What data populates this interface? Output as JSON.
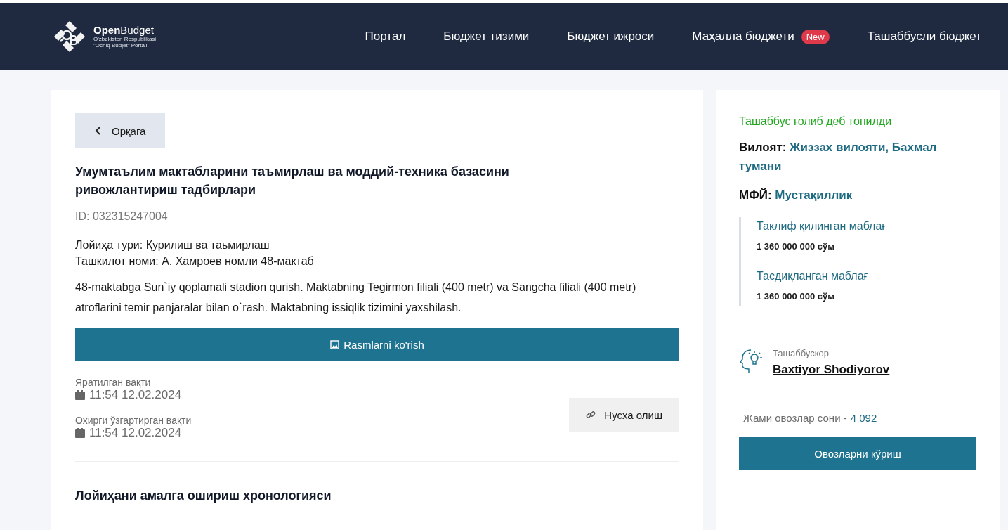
{
  "header": {
    "logo": {
      "name": "**Open**Budget",
      "subtitle_lines": [
        "O'zbekiston Respublikasi",
        "\"Ochiq Budjet\" Portali"
      ]
    },
    "nav": [
      {
        "label": "Портал"
      },
      {
        "label": "Бюджет тизими"
      },
      {
        "label": "Бюджет ижроси"
      },
      {
        "label": "Маҳалла бюджети",
        "badge": "New"
      },
      {
        "label": "Ташаббусли бюджет"
      }
    ]
  },
  "main": {
    "back_button": "Орқага",
    "title": "Умумтаълим мактабларини таъмирлаш ва моддий-техника базасини ривожлантириш тадбирлари",
    "id": "ID: 032315247004",
    "details": [
      "Лойиҳа тури: Қурилиш ва таьмирлаш",
      "Ташкилот номи: А. Хамроев номли 48-мактаб"
    ],
    "description": "48-maktabga Sun`iy qoplamali stadion qurish. Maktabning Tegirmon filiali (400 metr) va Sangcha filiali (400 metr) atroflarini temir panjaralar bilan o`rash. Maktabning issiqlik tizimini yaxshilash.",
    "photos_button": "Rasmlarni ko'rish",
    "dates": [
      {
        "label": "Яратилган вақти",
        "value": "11:54 12.02.2024"
      },
      {
        "label": "Охирги ўзгартирган вақти",
        "value": "11:54 12.02.2024"
      }
    ],
    "copy_button": "Нусха олиш",
    "section_title": "Лойиҳани амалга ошириш хронологияси"
  },
  "sidebar": {
    "status": "Ташаббус ғолиб деб топилди",
    "region_label": "Вилоят:",
    "region_value": "Жиззах вилояти, Бахмал тумани",
    "mfy_label": "МФЙ:",
    "mfy_value": "Мустақиллик",
    "amounts": [
      {
        "label": "Таклиф қилинган маблағ",
        "value": "1 360 000 000 сўм"
      },
      {
        "label": "Тасдиқланган маблағ",
        "value": "1 360 000 000 сўм"
      }
    ],
    "initiator_label": "Ташаббускор",
    "initiator_name": "Baxtiyor Shodiyorov",
    "votes_label": "Жами овозлар сони -",
    "votes_value": "4 092",
    "votes_button": "Овозларни кўриш"
  }
}
